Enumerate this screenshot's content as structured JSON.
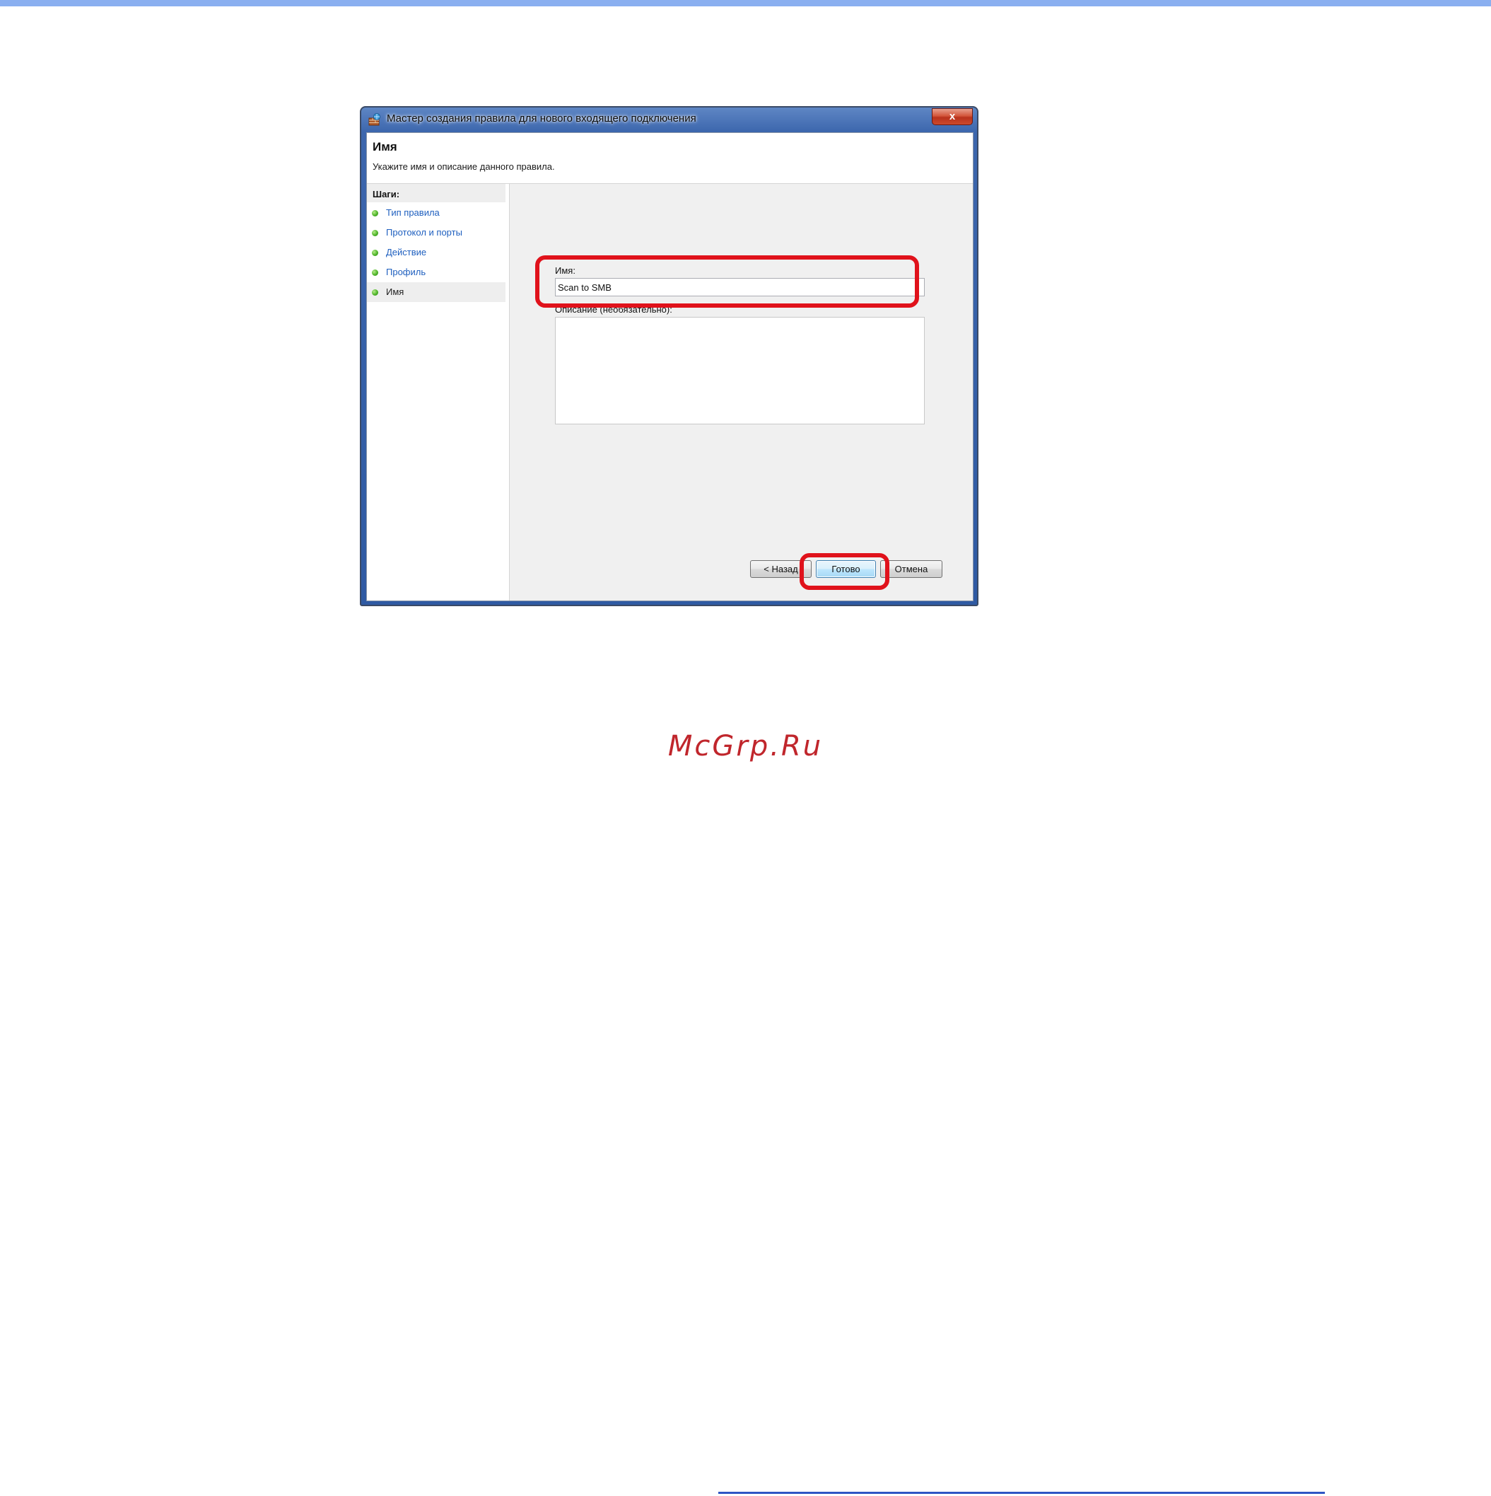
{
  "window": {
    "title": "Мастер создания правила для нового входящего подключения",
    "close_label": "x"
  },
  "header": {
    "title": "Имя",
    "subtitle": "Укажите имя и описание данного правила."
  },
  "sidebar": {
    "title": "Шаги:",
    "steps": [
      {
        "label": "Тип правила"
      },
      {
        "label": "Протокол и порты"
      },
      {
        "label": "Действие"
      },
      {
        "label": "Профиль"
      },
      {
        "label": "Имя"
      }
    ]
  },
  "form": {
    "name_label": "Имя:",
    "name_value": "Scan to SMB",
    "description_label": "Описание (необязательно):",
    "description_value": ""
  },
  "buttons": {
    "back": "< Назад",
    "finish": "Готово",
    "cancel": "Отмена"
  },
  "watermark": "McGrp.Ru",
  "colors": {
    "highlight": "#e0121b",
    "link": "#1e5fbf",
    "top_bar": "#8aaff0",
    "watermark": "#c0262c"
  }
}
